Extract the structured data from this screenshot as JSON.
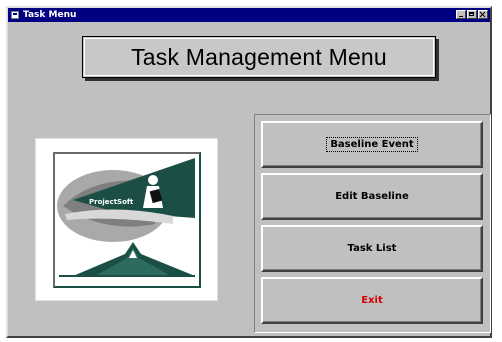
{
  "window": {
    "title": "Task Menu"
  },
  "header": {
    "title": "Task Management Menu"
  },
  "logo": {
    "text": "ProjectSoft"
  },
  "menu": {
    "buttons": [
      {
        "label": "Baseline Event",
        "color": "#000000"
      },
      {
        "label": "Edit Baseline",
        "color": "#000000"
      },
      {
        "label": "Task List",
        "color": "#000000"
      },
      {
        "label": "Exit",
        "color": "#d40000"
      }
    ]
  },
  "colors": {
    "titlebar": "#000080",
    "window_bg": "#c0c0c0",
    "logo_teal": "#1b4f46"
  }
}
